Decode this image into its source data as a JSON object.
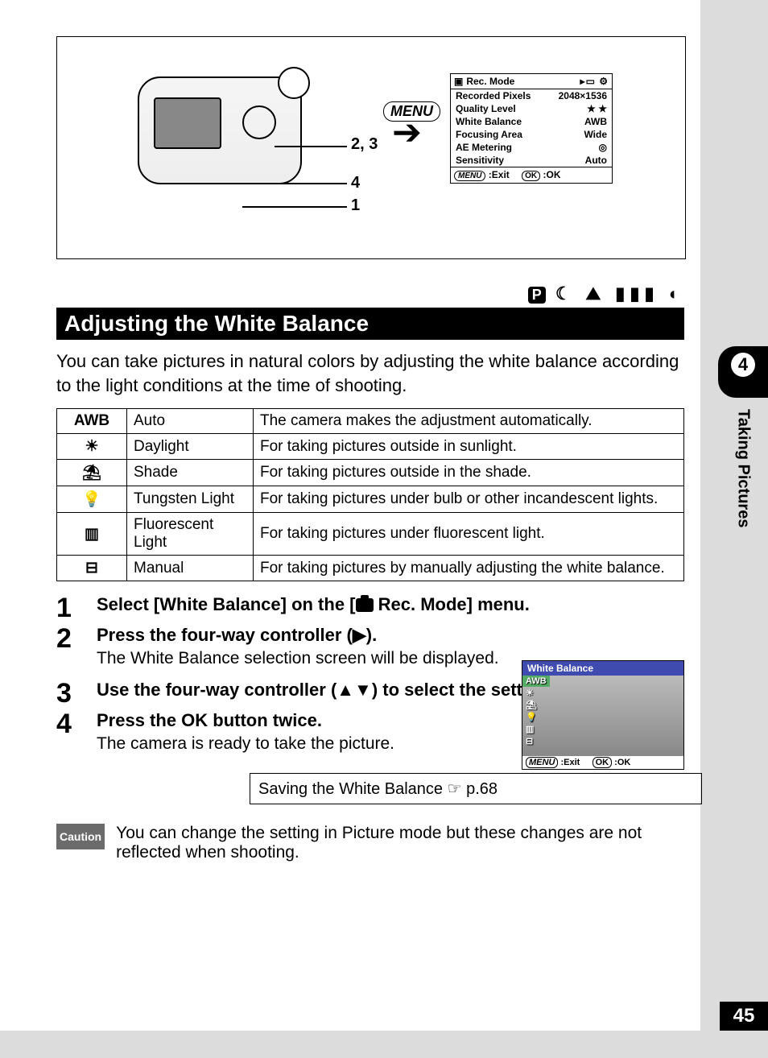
{
  "page_number": "45",
  "chapter": {
    "number": "4",
    "title": "Taking Pictures"
  },
  "diagram": {
    "menu_label": "MENU",
    "callouts": [
      "2, 3",
      "4",
      "1"
    ],
    "rec_panel": {
      "title": "Rec. Mode",
      "rows": [
        {
          "label": "Recorded Pixels",
          "value": "2048×1536"
        },
        {
          "label": "Quality Level",
          "value": "★ ★"
        },
        {
          "label": "White Balance",
          "value": "AWB"
        },
        {
          "label": "Focusing Area",
          "value": "Wide"
        },
        {
          "label": "AE Metering",
          "value": "◎"
        },
        {
          "label": "Sensitivity",
          "value": "Auto"
        }
      ],
      "footer_exit": "Exit",
      "footer_ok": "OK"
    }
  },
  "mode_icons_alt": "P  Night  Movie  Panorama  3D",
  "section_title": "Adjusting the White Balance",
  "intro": "You can take pictures in natural colors by adjusting the white balance according to the light conditions at the time of shooting.",
  "table": [
    {
      "icon": "AWB",
      "name": "Auto",
      "desc": "The camera makes the adjustment automatically."
    },
    {
      "icon": "☀",
      "name": "Daylight",
      "desc": "For taking pictures outside in sunlight."
    },
    {
      "icon": "⛱",
      "name": "Shade",
      "desc": "For taking pictures outside in the shade."
    },
    {
      "icon": "💡",
      "name": "Tungsten Light",
      "desc": "For taking pictures under bulb or other incandescent lights."
    },
    {
      "icon": "▥",
      "name": "Fluorescent Light",
      "desc": "For taking pictures under fluorescent light."
    },
    {
      "icon": "⊟",
      "name": "Manual",
      "desc": "For taking pictures by manually adjusting the white balance."
    }
  ],
  "steps": [
    {
      "n": "1",
      "title_pre": "Select [White Balance] on the [",
      "title_post": " Rec. Mode] menu.",
      "has_cam_icon": true
    },
    {
      "n": "2",
      "title": "Press the four-way controller (▶).",
      "desc": "The White Balance selection screen will be displayed."
    },
    {
      "n": "3",
      "title": "Use the four-way controller (▲▼) to select the setting."
    },
    {
      "n": "4",
      "title": "Press the OK button twice.",
      "desc": "The camera is ready to take the picture."
    }
  ],
  "wb_preview": {
    "title": "White Balance",
    "selected": "AWB",
    "options": [
      "AWB",
      "☀",
      "⛱",
      "💡",
      "▥",
      "⊟"
    ],
    "footer_menu": "MENU",
    "footer_exit": "Exit",
    "footer_ok_btn": "OK",
    "footer_ok": "OK"
  },
  "saving_ref": "Saving the White Balance ☞ p.68",
  "caution_label": "Caution",
  "caution_text": "You can change the setting in Picture mode but these changes are not reflected when shooting."
}
